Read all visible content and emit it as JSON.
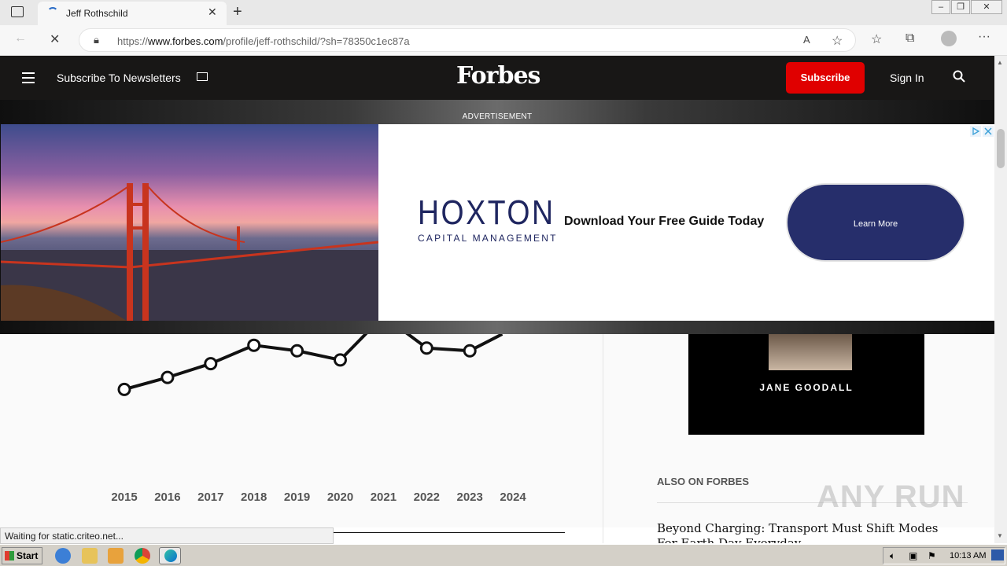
{
  "browser": {
    "tab_title": "Jeff Rothschild",
    "url_prefix": "https://",
    "url_domain": "www.forbes.com",
    "url_path": "/profile/jeff-rothschild/?sh=78350c1ec87a",
    "status_text": "Waiting for static.criteo.net..."
  },
  "header": {
    "newsletter_label": "Subscribe To Newsletters",
    "logo": "Forbes",
    "subscribe_label": "Subscribe",
    "signin_label": "Sign In"
  },
  "ad": {
    "label": "ADVERTISEMENT",
    "brand": "HOXTON",
    "brand_sub": "CAPITAL MANAGEMENT",
    "headline": "Download Your Free Guide Today",
    "cta_label": "Learn More"
  },
  "sidebar": {
    "promo_name": "JANE GOODALL",
    "also_label": "ALSO ON FORBES",
    "article_title": "Beyond Charging: Transport Must Shift Modes For Earth Day Everyday"
  },
  "chart_data": {
    "type": "line",
    "categories": [
      "2015",
      "2016",
      "2017",
      "2018",
      "2019",
      "2020",
      "2021",
      "2022",
      "2023",
      "2024"
    ],
    "values": [
      4.5,
      5.8,
      7.3,
      9.3,
      8.7,
      7.7,
      12.5,
      9.0,
      8.7,
      null
    ],
    "note_2024": "line rises off top of visible area after 2023",
    "ylim": [
      0,
      20
    ]
  },
  "watermark": "ANY RUN",
  "taskbar": {
    "start_label": "Start",
    "clock": "10:13 AM"
  }
}
